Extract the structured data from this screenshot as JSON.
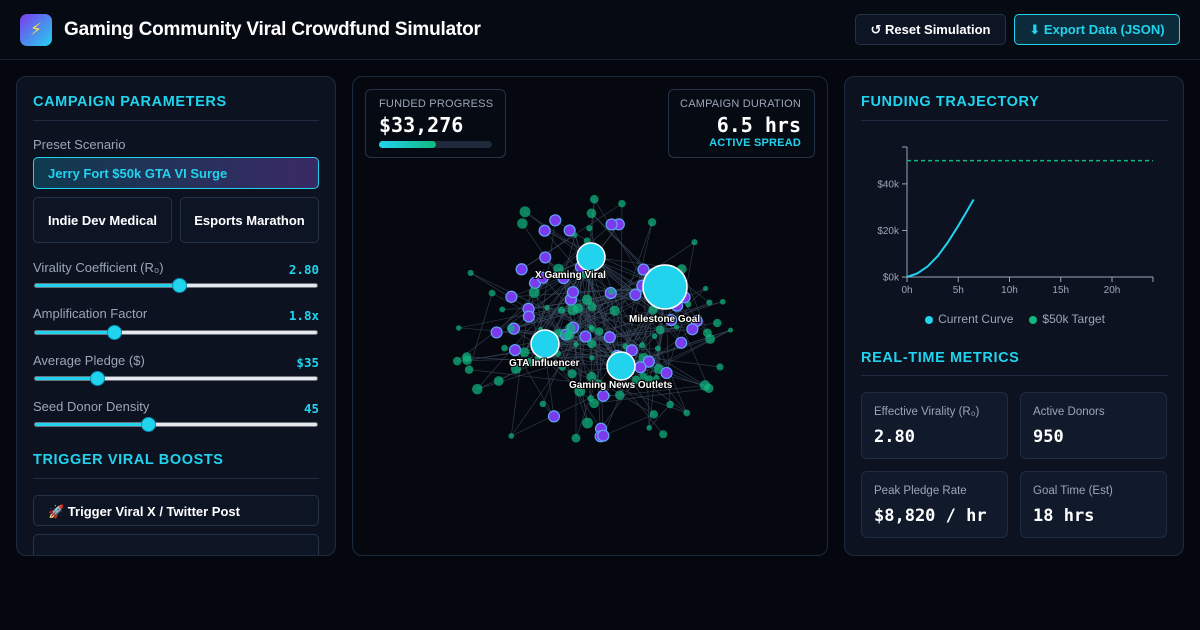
{
  "header": {
    "logo_icon": "lightning-icon",
    "title": "Gaming Community Viral Crowdfund Simulator",
    "reset_label": "↺ Reset Simulation",
    "export_label": "⬇ Export Data (JSON)"
  },
  "params": {
    "title": "CAMPAIGN PARAMETERS",
    "preset_label": "Preset Scenario",
    "preset_active": "Jerry Fort $50k GTA VI Surge",
    "preset_options": [
      "Indie Dev Medical",
      "Esports Marathon"
    ],
    "sliders": [
      {
        "label": "Virality Coefficient (R₀)",
        "value_text": "2.80",
        "fraction": 0.51
      },
      {
        "label": "Amplification Factor",
        "value_text": "1.8x",
        "fraction": 0.28
      },
      {
        "label": "Average Pledge ($)",
        "value_text": "$35",
        "fraction": 0.22
      },
      {
        "label": "Seed Donor Density",
        "value_text": "45",
        "fraction": 0.4
      }
    ]
  },
  "boosts": {
    "title": "TRIGGER VIRAL BOOSTS",
    "buttons": [
      "🚀 Trigger Viral X / Twitter Post",
      ""
    ]
  },
  "network": {
    "funded_label": "FUNDED PROGRESS",
    "funded_value": "$33,276",
    "funded_fraction": 0.5,
    "duration_label": "CAMPAIGN DURATION",
    "duration_value": "6.5 hrs",
    "status": "ACTIVE SPREAD",
    "hub_labels": [
      "X Gaming Viral",
      "Milestone Goal",
      "GTA Influencer",
      "Gaming News Outlets"
    ]
  },
  "trajectory": {
    "title": "FUNDING TRAJECTORY",
    "legend_current": "Current Curve",
    "legend_target": "$50k Target"
  },
  "chart_data": {
    "type": "line",
    "x_ticks": [
      "0h",
      "5h",
      "10h",
      "15h",
      "20h"
    ],
    "y_ticks": [
      "$0k",
      "$20k",
      "$40k"
    ],
    "xlim": [
      0,
      24
    ],
    "ylim": [
      0,
      55
    ],
    "series": [
      {
        "name": "Current Curve",
        "x": [
          0,
          1,
          2,
          3,
          4,
          5,
          6,
          6.5
        ],
        "y": [
          0,
          1.5,
          4.5,
          9,
          15,
          22,
          29.5,
          33.3
        ]
      },
      {
        "name": "$50k Target",
        "x": [
          0,
          24
        ],
        "y": [
          50,
          50
        ]
      }
    ],
    "colors": {
      "current": "#22d3ee",
      "target": "#10b981"
    }
  },
  "metrics": {
    "title": "REAL-TIME METRICS",
    "items": [
      {
        "label": "Effective Virality (R₀)",
        "value": "2.80"
      },
      {
        "label": "Active Donors",
        "value": "950"
      },
      {
        "label": "Peak Pledge Rate",
        "value": "$8,820 / hr"
      },
      {
        "label": "Goal Time (Est)",
        "value": "18 hrs"
      }
    ]
  },
  "colors": {
    "accent": "#22d3ee",
    "node_purple": "#7c3aed",
    "node_green": "#10b981"
  }
}
